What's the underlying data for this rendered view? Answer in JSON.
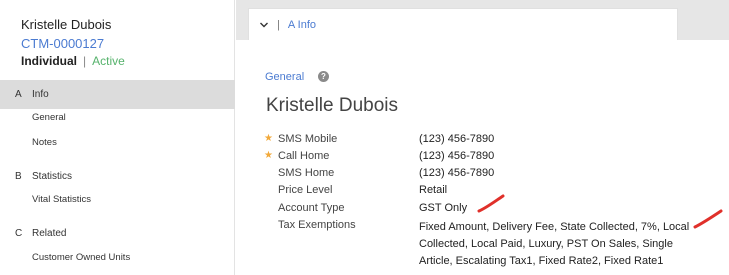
{
  "customer": {
    "name": "Kristelle Dubois",
    "id": "CTM-0000127",
    "type": "Individual",
    "status": "Active"
  },
  "sidebar": {
    "sections": [
      {
        "letter": "A",
        "label": "Info",
        "active": true,
        "items": [
          "General",
          "Notes"
        ]
      },
      {
        "letter": "B",
        "label": "Statistics",
        "active": false,
        "items": [
          "Vital Statistics"
        ]
      },
      {
        "letter": "C",
        "label": "Related",
        "active": false,
        "items": [
          "Customer Owned Units"
        ]
      }
    ]
  },
  "tab": {
    "label": "A Info",
    "separator": "|"
  },
  "general": {
    "section_title": "General",
    "record_title": "Kristelle Dubois",
    "fields": [
      {
        "label": "SMS Mobile",
        "value": "(123) 456-7890",
        "starred": true
      },
      {
        "label": "Call Home",
        "value": "(123) 456-7890",
        "starred": true
      },
      {
        "label": "SMS Home",
        "value": "(123) 456-7890",
        "starred": false
      },
      {
        "label": "Price Level",
        "value": "Retail",
        "starred": false
      },
      {
        "label": "Account Type",
        "value": "GST Only",
        "starred": false
      },
      {
        "label": "Tax Exemptions",
        "value": "Fixed Amount, Delivery Fee, State Collected, 7%, Local Collected, Local Paid, Luxury, PST On Sales, Single Article, Escalating Tax1, Fixed Rate2, Fixed Rate1",
        "starred": false
      }
    ]
  },
  "colors": {
    "accent": "#4b7bd1",
    "active_status": "#55b26b",
    "star": "#f2a93b",
    "annotation": "#e0302a"
  }
}
